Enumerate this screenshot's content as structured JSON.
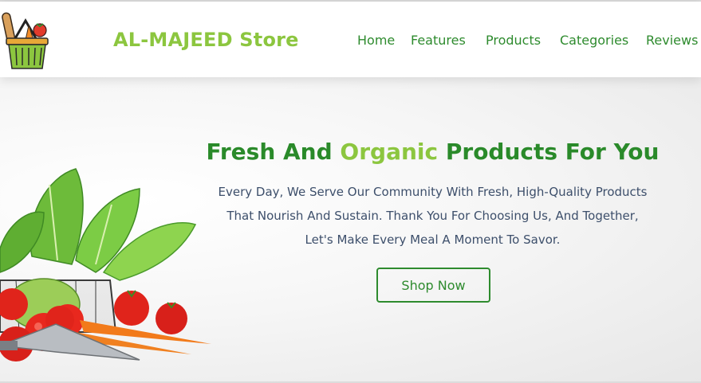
{
  "header": {
    "logo_icon": "grocery-basket-icon",
    "brand": "AL-MAJEED Store",
    "nav": [
      "Home",
      "Features",
      "Products",
      "Categories",
      "Reviews"
    ]
  },
  "hero": {
    "headline_part1": "Fresh And ",
    "headline_accent": "Organic",
    "headline_part2": " Products For You",
    "description_lines": [
      "Every Day, We Serve Our Community With Fresh, High-Quality Products",
      "That Nourish And Sustain. Thank You For Choosing Us, And Together,",
      "Let's Make Every Meal A Moment To Savor."
    ],
    "cta": "Shop Now",
    "image_icon": "vegetable-basket-image"
  },
  "colors": {
    "brand": "#8cc63f",
    "primary_green": "#2e8b2e",
    "text_muted": "#3d4f6b"
  }
}
